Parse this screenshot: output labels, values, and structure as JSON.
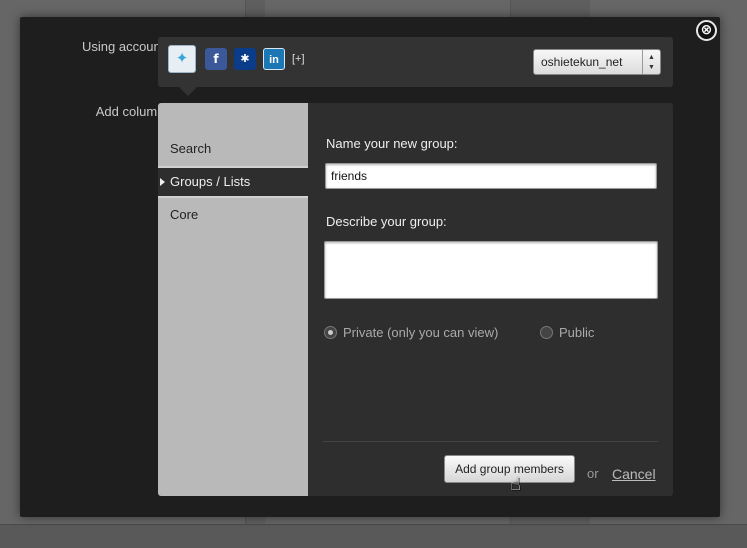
{
  "account": {
    "label": "Using account:",
    "services": [
      {
        "name": "twitter",
        "glyph": "🐦"
      },
      {
        "name": "facebook",
        "glyph": "f"
      },
      {
        "name": "myspace",
        "glyph": "M"
      },
      {
        "name": "linkedin",
        "glyph": "in"
      }
    ],
    "add_more": "[+]",
    "selected_account": "oshietekun_net"
  },
  "add_column": {
    "label": "Add column:",
    "menu": [
      {
        "label": "Search"
      },
      {
        "label": "Groups / Lists",
        "active": true
      },
      {
        "label": "Core"
      }
    ]
  },
  "form": {
    "name_label": "Name your new group:",
    "name_value": "friends",
    "desc_label": "Describe your group:",
    "desc_value": "",
    "privacy": {
      "private_label": "Private (only you can view)",
      "public_label": "Public",
      "selected": "private"
    },
    "submit_label": "Add group members",
    "or_text": "or",
    "cancel_label": "Cancel"
  },
  "close_icon": "⊗",
  "colors": {
    "modal": "#1e1e1e",
    "panel": "#2e2e2e",
    "menu": "#b9b9b9"
  }
}
